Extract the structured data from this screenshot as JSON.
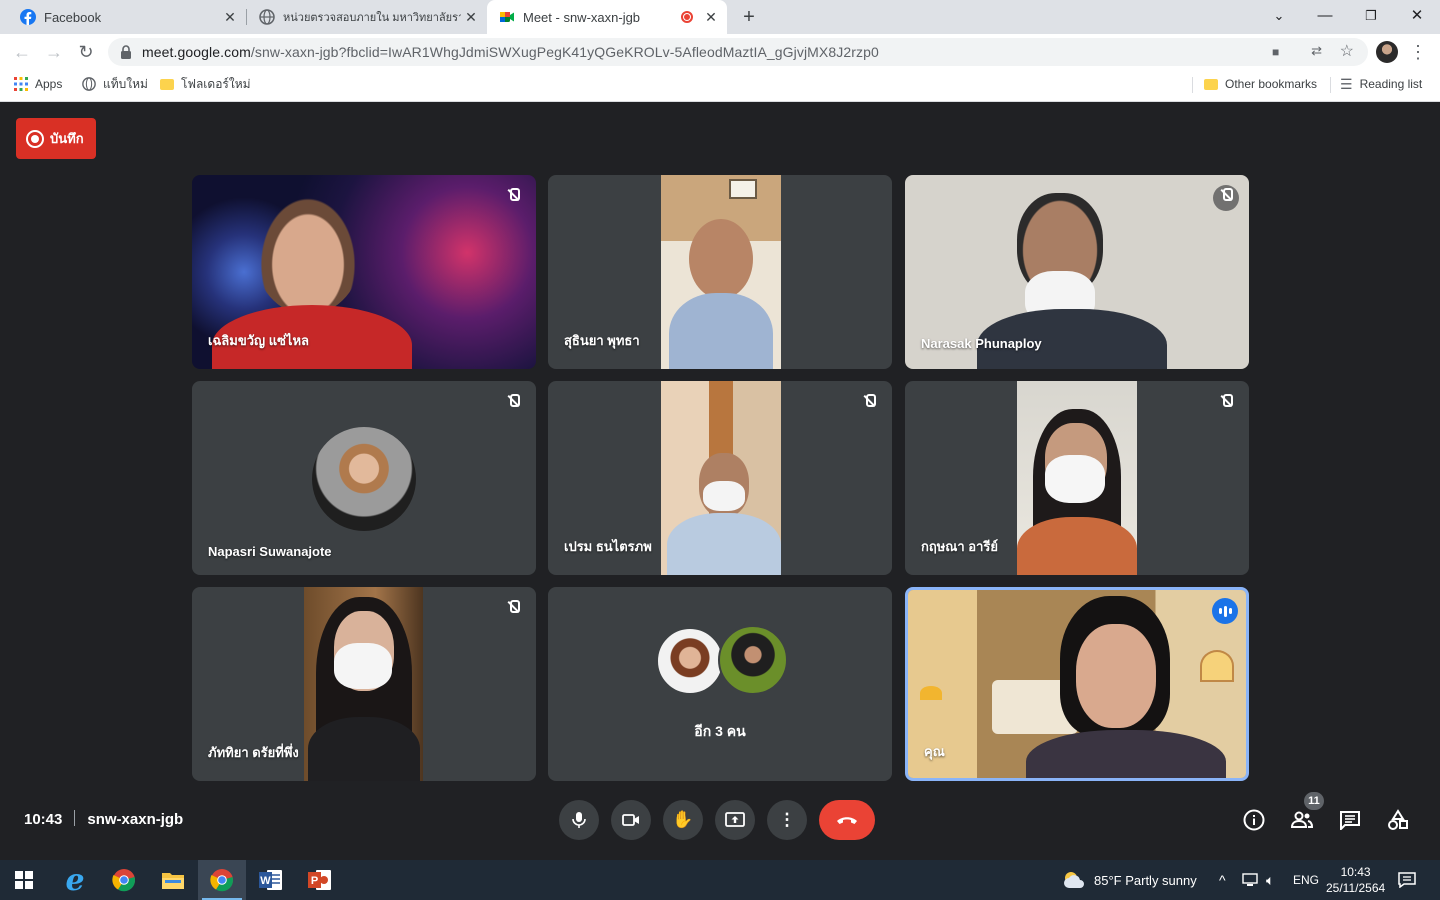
{
  "tabs": [
    {
      "title": "Facebook",
      "icon": "facebook-icon"
    },
    {
      "title": "หน่วยตรวจสอบภายใน มหาวิทยาลัยราช",
      "icon": "globe-icon"
    },
    {
      "title": "Meet - snw-xaxn-jgb",
      "icon": "google-meet-icon",
      "recording": true
    }
  ],
  "new_tab_label": "+",
  "address_bar": {
    "host": "meet.google.com",
    "path": "/snw-xaxn-jgb?fbclid=IwAR1WhgJdmiSWXugPegK41yQGeKROLv-5AfleodMaztIA_gGjvjMX8J2rzp0"
  },
  "bookmarks": {
    "apps": "Apps",
    "new_tab": "แท็บใหม่",
    "new_folder": "โฟลเดอร์ใหม่",
    "other": "Other bookmarks",
    "reading_list": "Reading list"
  },
  "meeting": {
    "record_label": "บันทึก",
    "time": "10:43",
    "code": "snw-xaxn-jgb",
    "participant_count": "11",
    "others_label": "อีก 3 คน",
    "participants": [
      {
        "name": "เฉลิมขวัญ แซ่ไหล",
        "muted": true
      },
      {
        "name": "สุธินยา พุทธา",
        "muted": false
      },
      {
        "name": "Narasak Phunaploy",
        "muted": true
      },
      {
        "name": "Napasri Suwanajote",
        "muted": true
      },
      {
        "name": "เปรม ธนไตรภพ",
        "muted": true
      },
      {
        "name": "กฤษณา อารีย์",
        "muted": true
      },
      {
        "name": "ภัททิยา ดรัยที่พึ่ง",
        "muted": true
      },
      {
        "name": "คุณ",
        "muted": false,
        "speaking": true
      }
    ]
  },
  "taskbar": {
    "weather": "85°F  Partly sunny",
    "language": "ENG",
    "time": "10:43",
    "date": "25/11/2564"
  },
  "colors": {
    "meet_bg": "#202124",
    "tile_bg": "#3c4043",
    "record_red": "#d93025",
    "end_call_red": "#ea4335",
    "speaking_blue": "#1a73e8"
  }
}
